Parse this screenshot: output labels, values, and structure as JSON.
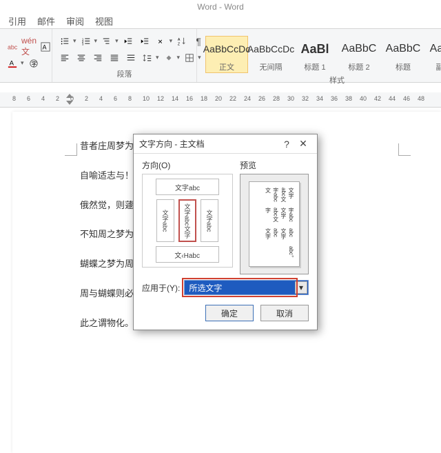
{
  "window_title": "Word - Word",
  "tabs": [
    "引用",
    "邮件",
    "审阅",
    "视图"
  ],
  "paragraph_group": "段落",
  "styles_group": "样式",
  "styles": [
    {
      "preview": "AaBbCcDc",
      "name": "正文"
    },
    {
      "preview": "AaBbCcDc",
      "name": "无间隔"
    },
    {
      "preview": "AaBl",
      "name": "标题 1"
    },
    {
      "preview": "AaBbC",
      "name": "标题 2"
    },
    {
      "preview": "AaBbC",
      "name": "标题"
    },
    {
      "preview": "AaBbC",
      "name": "副标题"
    }
  ],
  "ruler_ticks": [
    8,
    6,
    4,
    2,
    0,
    2,
    4,
    6,
    8,
    10,
    12,
    14,
    16,
    18,
    20,
    22,
    24,
    26,
    28,
    30,
    32,
    34,
    36,
    38,
    40,
    42,
    44,
    46,
    48
  ],
  "doc_lines": [
    "昔者庄周梦为蝴",
    "自喻适志与！不",
    "俄然觉，则蘧蘧",
    "不知周之梦为蝴",
    "蝴蝶之梦为周与",
    "周与蝴蝶则必有分矣。↵",
    "此之谓物化。↵"
  ],
  "dialog": {
    "title": "文字方向 - 主文档",
    "orientation_label": "方向(O)",
    "preview_label": "预览",
    "opt_horizontal": "文字abc",
    "opt_v1": "文字abc",
    "opt_v2": "文字abc文字",
    "opt_v3": "文字abc",
    "opt_vb": "文‹Habc",
    "preview_lines": [
      "文字abc文字abc文",
      "字abc文字abc文字",
      "abc文字abc文字",
      "abc。"
    ],
    "apply_label": "应用于(Y):",
    "apply_value": "所选文字",
    "ok": "确定",
    "cancel": "取消"
  }
}
